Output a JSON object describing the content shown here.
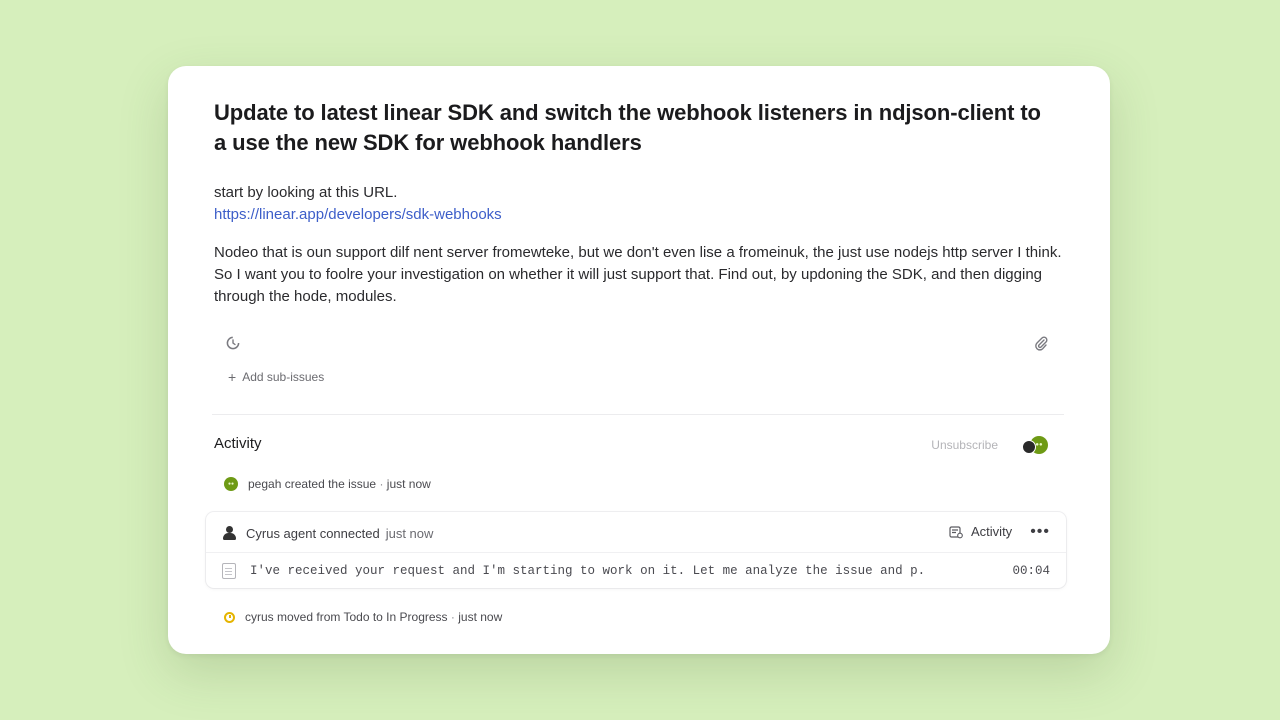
{
  "issue": {
    "title": "Update to latest linear SDK and switch the webhook listeners in ndjson-client to a use the new SDK for webhook handlers",
    "description_intro": "start by looking at this URL.",
    "description_link": "https://linear.app/developers/sdk-webhooks",
    "description_body": "Nodeo that is oun support dilf nent server fromewteke, but we don't even lise a fromeinuk, the just use nodejs http server I think. So I want you to foolre your investigation on whether it will just support that. Find out, by updoning the SDK, and then digging through the hode, modules."
  },
  "toolbar": {
    "sub_issue_icon": "cycle-icon",
    "attach_icon": "paperclip-icon",
    "add_sub_issues": "Add sub-issues"
  },
  "activity": {
    "heading": "Activity",
    "unsubscribe": "Unsubscribe",
    "events": [
      {
        "actor": "pegah",
        "action": "created the issue",
        "separator": "·",
        "time": "just now"
      },
      {
        "actor": "cyrus",
        "action": "moved from Todo to In Progress",
        "separator": "·",
        "time": "just now"
      }
    ],
    "agent": {
      "name": "Cyrus agent connected",
      "time": "just now",
      "activity_label": "Activity",
      "more": "•••",
      "message": "I've received your request and I'm starting to work on it. Let me analyze the issue and p.",
      "message_time": "00:04"
    }
  },
  "colors": {
    "background": "#d6efbc",
    "link": "#3d5ec9",
    "avatar_green": "#6e9a15",
    "status_yellow": "#e5b400"
  }
}
